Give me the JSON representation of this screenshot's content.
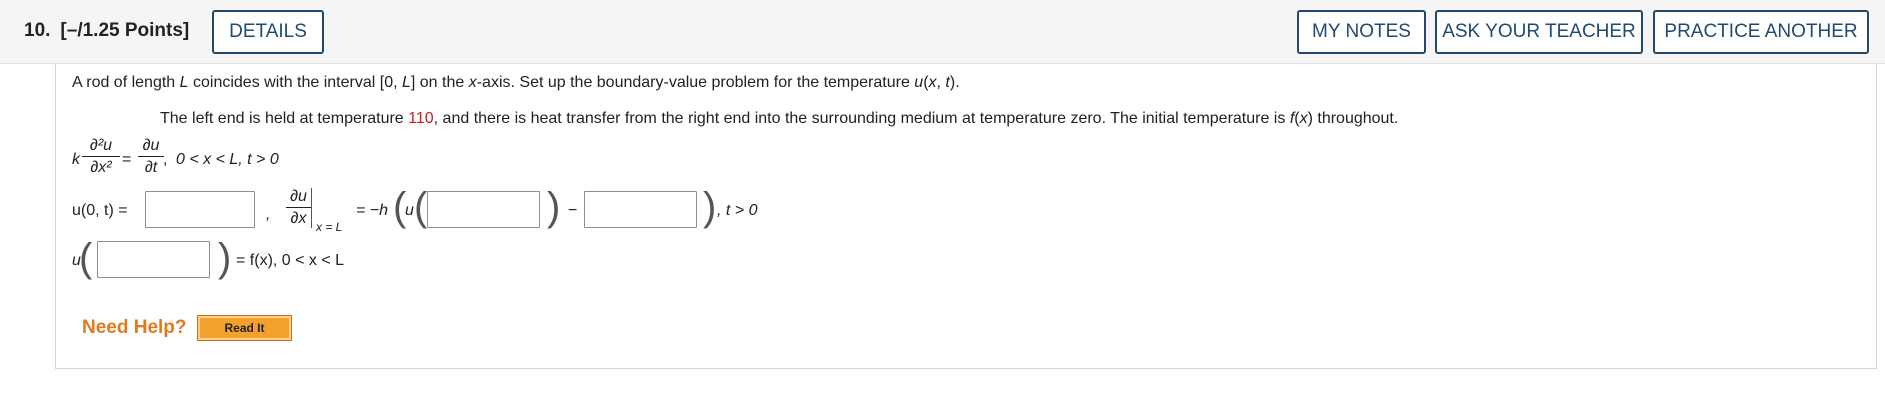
{
  "header": {
    "question_number": "10.",
    "points": "[–/1.25 Points]",
    "details_label": "DETAILS",
    "my_notes_label": "MY NOTES",
    "ask_teacher_label": "ASK YOUR TEACHER",
    "practice_another_label": "PRACTICE ANOTHER"
  },
  "problem": {
    "s1_a": "A rod of length ",
    "s1_L": "L",
    "s1_b": " coincides with the interval [0, ",
    "s1_L2": "L",
    "s1_c": "] on the ",
    "s1_x": "x",
    "s1_d": "-axis. Set up the boundary-value problem for the temperature ",
    "s1_u": "u",
    "s1_e": "(",
    "s1_x2": "x",
    "s1_f": ", ",
    "s1_t": "t",
    "s1_g": ").",
    "s2_a": "The left end is held at temperature ",
    "s2_temp": "110",
    "s2_b": ", and there is heat transfer from the right end into the surrounding medium at temperature zero. The initial temperature is ",
    "s2_f": "f",
    "s2_c": "(",
    "s2_x": "x",
    "s2_d": ") throughout."
  },
  "equations": {
    "pde_k": "k",
    "pde_num1": "∂²u",
    "pde_den1": "∂x²",
    "pde_eq": "=",
    "pde_num2": "∂u",
    "pde_den2": "∂t",
    "pde_comma": ",",
    "pde_cond": "0 < x < L, t > 0",
    "bc1_label": "u(0, t) =",
    "bc1_comma": ",",
    "bc2_num": "∂u",
    "bc2_den": "∂x",
    "bc2_sub": "x = L",
    "bc2_eq": "= −h",
    "bc2_u": "u",
    "bc2_minus": "−",
    "bc2_tail": ", t > 0",
    "ic_u": "u",
    "ic_tail": "= f(x),  0 < x < L"
  },
  "answers": {
    "bc1_value": "",
    "bc2_arg": "",
    "bc2_second": "",
    "ic_arg": ""
  },
  "help": {
    "need_help": "Need Help?",
    "read_it": "Read It"
  },
  "colors": {
    "accent_button_border": "#23486b",
    "given_value": "#c8201f",
    "help_text": "#e07b1b",
    "read_it_bg": "#f3a12d"
  }
}
